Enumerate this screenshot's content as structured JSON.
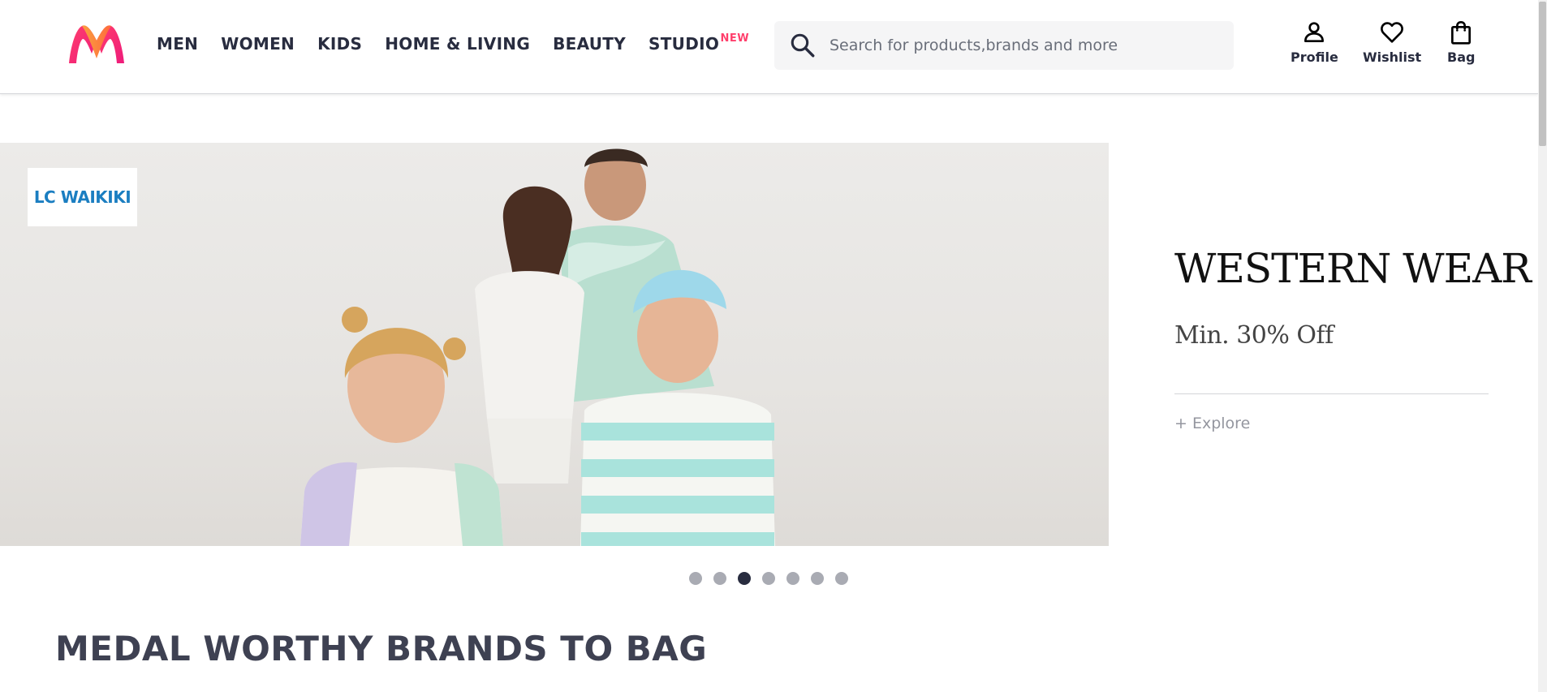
{
  "header": {
    "logo_icon": "myntra-m-logo",
    "nav": [
      {
        "label": "MEN"
      },
      {
        "label": "WOMEN"
      },
      {
        "label": "KIDS"
      },
      {
        "label": "HOME & LIVING"
      },
      {
        "label": "BEAUTY"
      },
      {
        "label": "STUDIO",
        "badge": "NEW"
      }
    ],
    "search": {
      "icon": "search-icon",
      "placeholder": "Search for products,brands and more",
      "value": ""
    },
    "actions": {
      "profile": {
        "label": "Profile",
        "icon": "profile-icon"
      },
      "wishlist": {
        "label": "Wishlist",
        "icon": "heart-icon"
      },
      "bag": {
        "label": "Bag",
        "icon": "bag-icon"
      }
    }
  },
  "banner": {
    "brand": "LC WAIKIKI",
    "title": "WESTERN WEAR",
    "subtitle": "Min. 30% Off",
    "cta": "+ Explore"
  },
  "carousel": {
    "total_slides": 7,
    "active_slide": 3
  },
  "section": {
    "title": "MEDAL WORTHY BRANDS TO BAG"
  },
  "colors": {
    "brand_pink": "#ff3f6c",
    "text_dark": "#282c3f",
    "brand_logo_blue": "#1b7ec1"
  }
}
